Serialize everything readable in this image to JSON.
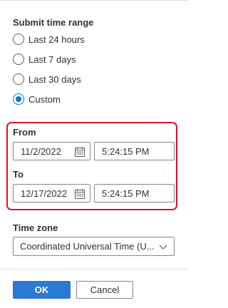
{
  "submit_time_range": {
    "title": "Submit time range",
    "options": [
      {
        "label": "Last 24 hours",
        "checked": false
      },
      {
        "label": "Last 7 days",
        "checked": false
      },
      {
        "label": "Last 30 days",
        "checked": false
      },
      {
        "label": "Custom",
        "checked": true
      }
    ]
  },
  "custom_range": {
    "from_label": "From",
    "from_date": "11/2/2022",
    "from_time": "5:24:15 PM",
    "to_label": "To",
    "to_date": "12/17/2022",
    "to_time": "5:24:15 PM",
    "highlight_color": "#d9122b"
  },
  "time_zone": {
    "label": "Time zone",
    "value": "Coordinated Universal Time (U..."
  },
  "buttons": {
    "ok_label": "OK",
    "cancel_label": "Cancel"
  },
  "colors": {
    "accent": "#0078d4",
    "primary_button": "#2b79d3"
  },
  "icons": {
    "calendar": "calendar-icon",
    "chevron": "chevron-down-icon"
  }
}
